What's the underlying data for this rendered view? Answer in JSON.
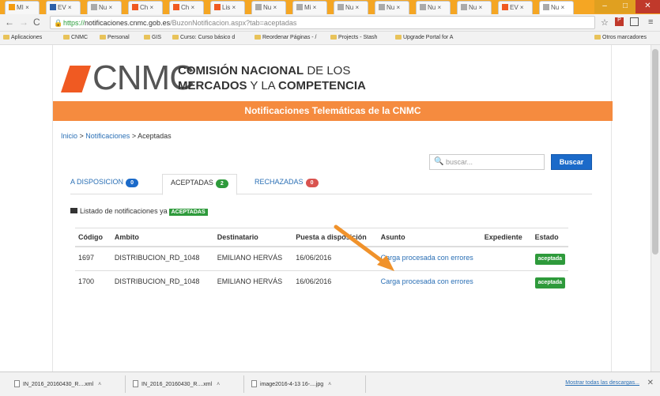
{
  "browser": {
    "tabs": [
      {
        "label": "MI ×",
        "color": "#f39c12"
      },
      {
        "label": "EV ×",
        "color": "#2c5fa8"
      },
      {
        "label": "Nu ×",
        "color": "#aaaaaa"
      },
      {
        "label": "Ch ×",
        "color": "#f05a22"
      },
      {
        "label": "Ch ×",
        "color": "#f05a22"
      },
      {
        "label": "Lis ×",
        "color": "#f05a22"
      },
      {
        "label": "Nu ×",
        "color": "#aaaaaa"
      },
      {
        "label": "Mi ×",
        "color": "#aaaaaa"
      },
      {
        "label": "Nu ×",
        "color": "#aaaaaa"
      },
      {
        "label": "Nu ×",
        "color": "#aaaaaa"
      },
      {
        "label": "Nu ×",
        "color": "#aaaaaa"
      },
      {
        "label": "Nu ×",
        "color": "#aaaaaa"
      },
      {
        "label": "EV ×",
        "color": "#f05a22"
      },
      {
        "label": "Nu ×",
        "color": "#aaaaaa"
      }
    ],
    "url_https": "https://",
    "url_host": "notificaciones.cnmc.gob.es",
    "url_path": "/BuzonNotificacion.aspx?tab=aceptadas",
    "bookmarks": [
      "Aplicaciones",
      "CNMC",
      "Personal",
      "GIS",
      "Curso: Curso básico d",
      "Reordenar Páginas - /",
      "Projects - Stash",
      "Upgrade Portal for A"
    ],
    "other_bookmarks": "Otros marcadores"
  },
  "site": {
    "logo_text": "CNMC",
    "logo_line1_bold": "COMISIÓN NACIONAL",
    "logo_line1_rest": " DE LOS",
    "logo_line2_bold": "MERCADOS",
    "logo_line2_mid": " Y LA ",
    "logo_line2_bold2": "COMPETENCIA",
    "banner": "Notificaciones Telemáticas de la CNMC",
    "brand_color": "#f05a22",
    "banner_color": "#f58b3f"
  },
  "breadcrumb": {
    "home": "Inicio",
    "sep": " > ",
    "section": "Notificaciones",
    "current": "Aceptadas"
  },
  "search": {
    "placeholder": "buscar...",
    "button": "Buscar"
  },
  "tabs": [
    {
      "label": "A DISPOSICION",
      "count": "0",
      "badge_color": "#1b6ac9"
    },
    {
      "label": "ACEPTADAS",
      "count": "2",
      "badge_color": "#2e9a3b"
    },
    {
      "label": "RECHAZADAS",
      "count": "0",
      "badge_color": "#d9534f"
    }
  ],
  "listing": {
    "text": "Listado de notificaciones ya",
    "tag": "ACEPTADAS"
  },
  "table": {
    "headers": [
      "Código",
      "Ambito",
      "Destinatario",
      "Puesta a disposición",
      "Asunto",
      "Expediente",
      "Estado"
    ],
    "rows": [
      {
        "codigo": "1697",
        "ambito": "DISTRIBUCION_RD_1048",
        "destinatario": "EMILIANO HERVÁS",
        "puesta": "16/06/2016",
        "asunto": "Carga procesada con errores",
        "expediente": "",
        "estado": "aceptada"
      },
      {
        "codigo": "1700",
        "ambito": "DISTRIBUCION_RD_1048",
        "destinatario": "EMILIANO HERVÁS",
        "puesta": "16/06/2016",
        "asunto": "Carga procesada con errores",
        "expediente": "",
        "estado": "aceptada"
      }
    ]
  },
  "downloads": {
    "items": [
      "IN_2016_20160430_R....xml",
      "IN_2016_20160430_R....xml",
      "image2016-4-13 16-....jpg"
    ],
    "show_all": "Mostrar todas las descargas..."
  },
  "annotation_arrow_color": "#f0922b"
}
